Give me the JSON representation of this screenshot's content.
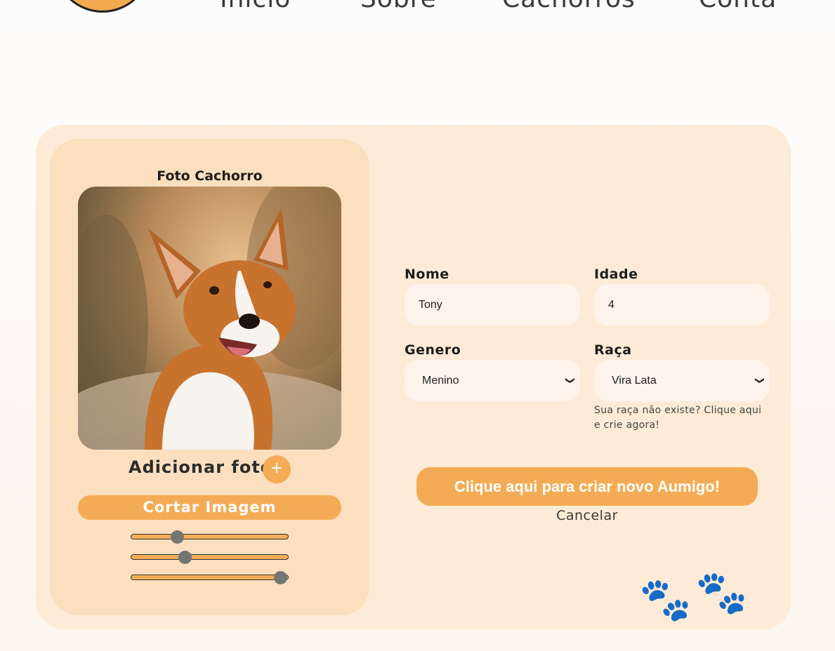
{
  "nav": {
    "items": [
      "Início",
      "Sobre",
      "Cachorros",
      "Conta"
    ]
  },
  "photo_panel": {
    "title": "Foto Cachorro",
    "add_photo_label": "Adicionar foto",
    "add_photo_button": "+",
    "crop_button": "Cortar Imagem",
    "sliders": [
      0.29,
      0.34,
      0.95
    ]
  },
  "form": {
    "name": {
      "label": "Nome",
      "value": "Tony"
    },
    "age": {
      "label": "Idade",
      "value": "4"
    },
    "gender": {
      "label": "Genero",
      "selected": "Menino"
    },
    "breed": {
      "label": "Raça",
      "selected": "Vira Lata"
    },
    "breed_hint": "Sua raça não existe? Clique aqui e crie agora!",
    "submit_label": "Clique aqui para criar novo Aumigo!",
    "cancel_label": "Cancelar"
  },
  "colors": {
    "accent": "#f3ac55",
    "card": "#fdebd7",
    "panel": "#fbdfbe",
    "input": "#fef4ec"
  },
  "icons": {
    "select_arrow": "chevron-down-icon",
    "add": "plus-icon",
    "decoration": "paw-icon"
  }
}
